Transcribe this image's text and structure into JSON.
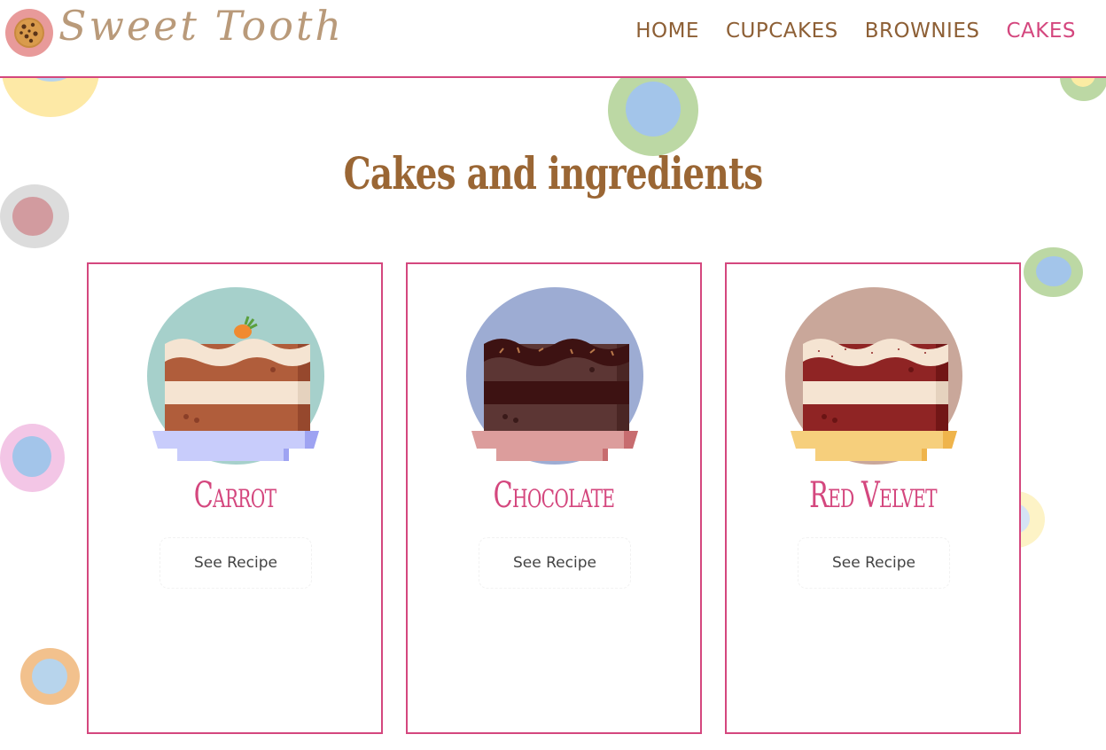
{
  "brand": {
    "name": "Sweet Tooth",
    "logo_icon": "cookie-icon"
  },
  "nav": {
    "items": [
      {
        "label": "HOME",
        "active": false
      },
      {
        "label": "CUPCAKES",
        "active": false
      },
      {
        "label": "BROWNIES",
        "active": false
      },
      {
        "label": "CAKES",
        "active": true
      }
    ]
  },
  "page": {
    "title": "Cakes and ingredients"
  },
  "cards": [
    {
      "name": "Carrot",
      "button": "See Recipe",
      "icon": "carrot-cake-icon"
    },
    {
      "name": "Chocolate",
      "button": "See Recipe",
      "icon": "chocolate-cake-icon"
    },
    {
      "name": "Red Velvet",
      "button": "See Recipe",
      "icon": "red-velvet-cake-icon"
    }
  ],
  "colors": {
    "accent": "#d4477e",
    "brown": "#9a6634",
    "nav_text": "#8d5f35"
  }
}
